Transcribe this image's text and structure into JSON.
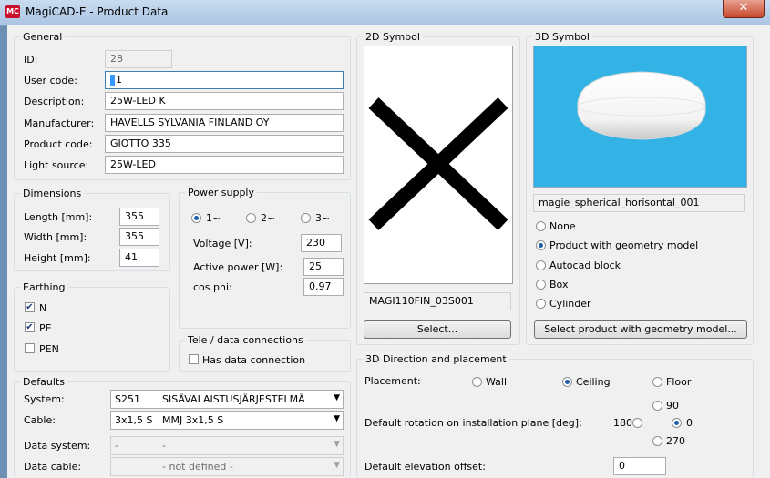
{
  "window": {
    "title": "MagiCAD-E - Product Data",
    "icon_text": "MC",
    "close_glyph": "✕"
  },
  "general": {
    "legend": "General",
    "id_label": "ID:",
    "id_value": "28",
    "user_code_label": "User code:",
    "user_code_value": "1",
    "description_label": "Description:",
    "description_value": "25W-LED K",
    "manufacturer_label": "Manufacturer:",
    "manufacturer_value": "HAVELLS SYLVANIA FINLAND OY",
    "product_code_label": "Product code:",
    "product_code_value": "GIOTTO 335",
    "light_source_label": "Light source:",
    "light_source_value": "25W-LED"
  },
  "dimensions": {
    "legend": "Dimensions",
    "length_label": "Length [mm]:",
    "length_value": "355",
    "width_label": "Width [mm]:",
    "width_value": "355",
    "height_label": "Height [mm]:",
    "height_value": "41"
  },
  "power": {
    "legend": "Power supply",
    "phase1": "1~",
    "phase2": "2~",
    "phase3": "3~",
    "selected_phase": "1~",
    "voltage_label": "Voltage [V]:",
    "voltage_value": "230",
    "active_power_label": "Active power [W]:",
    "active_power_value": "25",
    "cosphi_label": "cos phi:",
    "cosphi_value": "0.97"
  },
  "earthing": {
    "legend": "Earthing",
    "n_label": "N",
    "pe_label": "PE",
    "pen_label": "PEN",
    "checkmark": "✔"
  },
  "tele": {
    "legend": "Tele / data connections",
    "has_data_label": "Has data connection"
  },
  "defaults": {
    "legend": "Defaults",
    "system_label": "System:",
    "system_code": "S251",
    "system_name": "SISÄVALAISTUSJÄRJESTELMÄ",
    "cable_label": "Cable:",
    "cable_code": "3x1,5 S",
    "cable_name": "MMJ 3x1,5 S",
    "data_system_label": "Data system:",
    "data_system_code": "-",
    "data_system_name": "-",
    "data_cable_label": "Data cable:",
    "data_cable_name": "- not defined -",
    "arrow": "▼"
  },
  "symbol2d": {
    "legend": "2D Symbol",
    "name": "MAGI110FIN_03S001",
    "select_label": "Select..."
  },
  "symbol3d": {
    "legend": "3D Symbol",
    "name": "magie_spherical_horisontal_001",
    "opt_none": "None",
    "opt_geometry": "Product with geometry model",
    "opt_autocad": "Autocad block",
    "opt_box": "Box",
    "opt_cylinder": "Cylinder",
    "selected": "Product with geometry model",
    "select_label": "Select product with geometry model...",
    "preview_color": "#33b2e5"
  },
  "placement": {
    "legend": "3D Direction and placement",
    "placement_label": "Placement:",
    "wall": "Wall",
    "ceiling": "Ceiling",
    "floor": "Floor",
    "selected_placement": "Ceiling",
    "rotation_label": "Default rotation on installation plane [deg]:",
    "r90": "90",
    "r180": "180",
    "r0": "0",
    "r270": "270",
    "selected_rotation": "0",
    "elevation_label": "Default elevation offset:",
    "elevation_value": "0"
  }
}
